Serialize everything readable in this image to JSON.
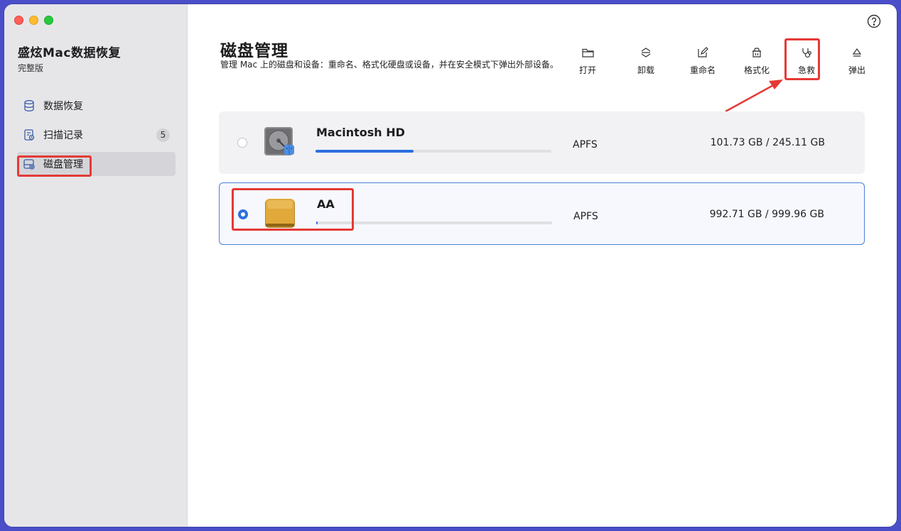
{
  "app": {
    "title": "盛炫Mac数据恢复",
    "edition": "完整版"
  },
  "sidebar": {
    "items": [
      {
        "label": "数据恢复",
        "icon": "database-icon"
      },
      {
        "label": "扫描记录",
        "icon": "scan-history-icon",
        "badge": "5"
      },
      {
        "label": "磁盘管理",
        "icon": "disk-manage-icon",
        "active": true
      }
    ]
  },
  "main": {
    "title": "磁盘管理",
    "description": "管理 Mac 上的磁盘和设备：重命名、格式化硬盘或设备，并在安全模式下弹出外部设备。"
  },
  "toolbar": {
    "open": "打开",
    "unmount": "卸载",
    "rename": "重命名",
    "format": "格式化",
    "rescue": "急救",
    "eject": "弹出"
  },
  "disks": [
    {
      "name": "Macintosh HD",
      "fs": "APFS",
      "usage": "101.73 GB / 245.11 GB",
      "used_fraction": 0.415,
      "selected": false
    },
    {
      "name": "AA",
      "fs": "APFS",
      "usage": "992.71 GB / 999.96 GB",
      "used_fraction": 0.007,
      "selected": true
    }
  ],
  "colors": {
    "accent": "#2d6fe0",
    "highlight": "#e53935",
    "frame": "#4a4fc9"
  }
}
